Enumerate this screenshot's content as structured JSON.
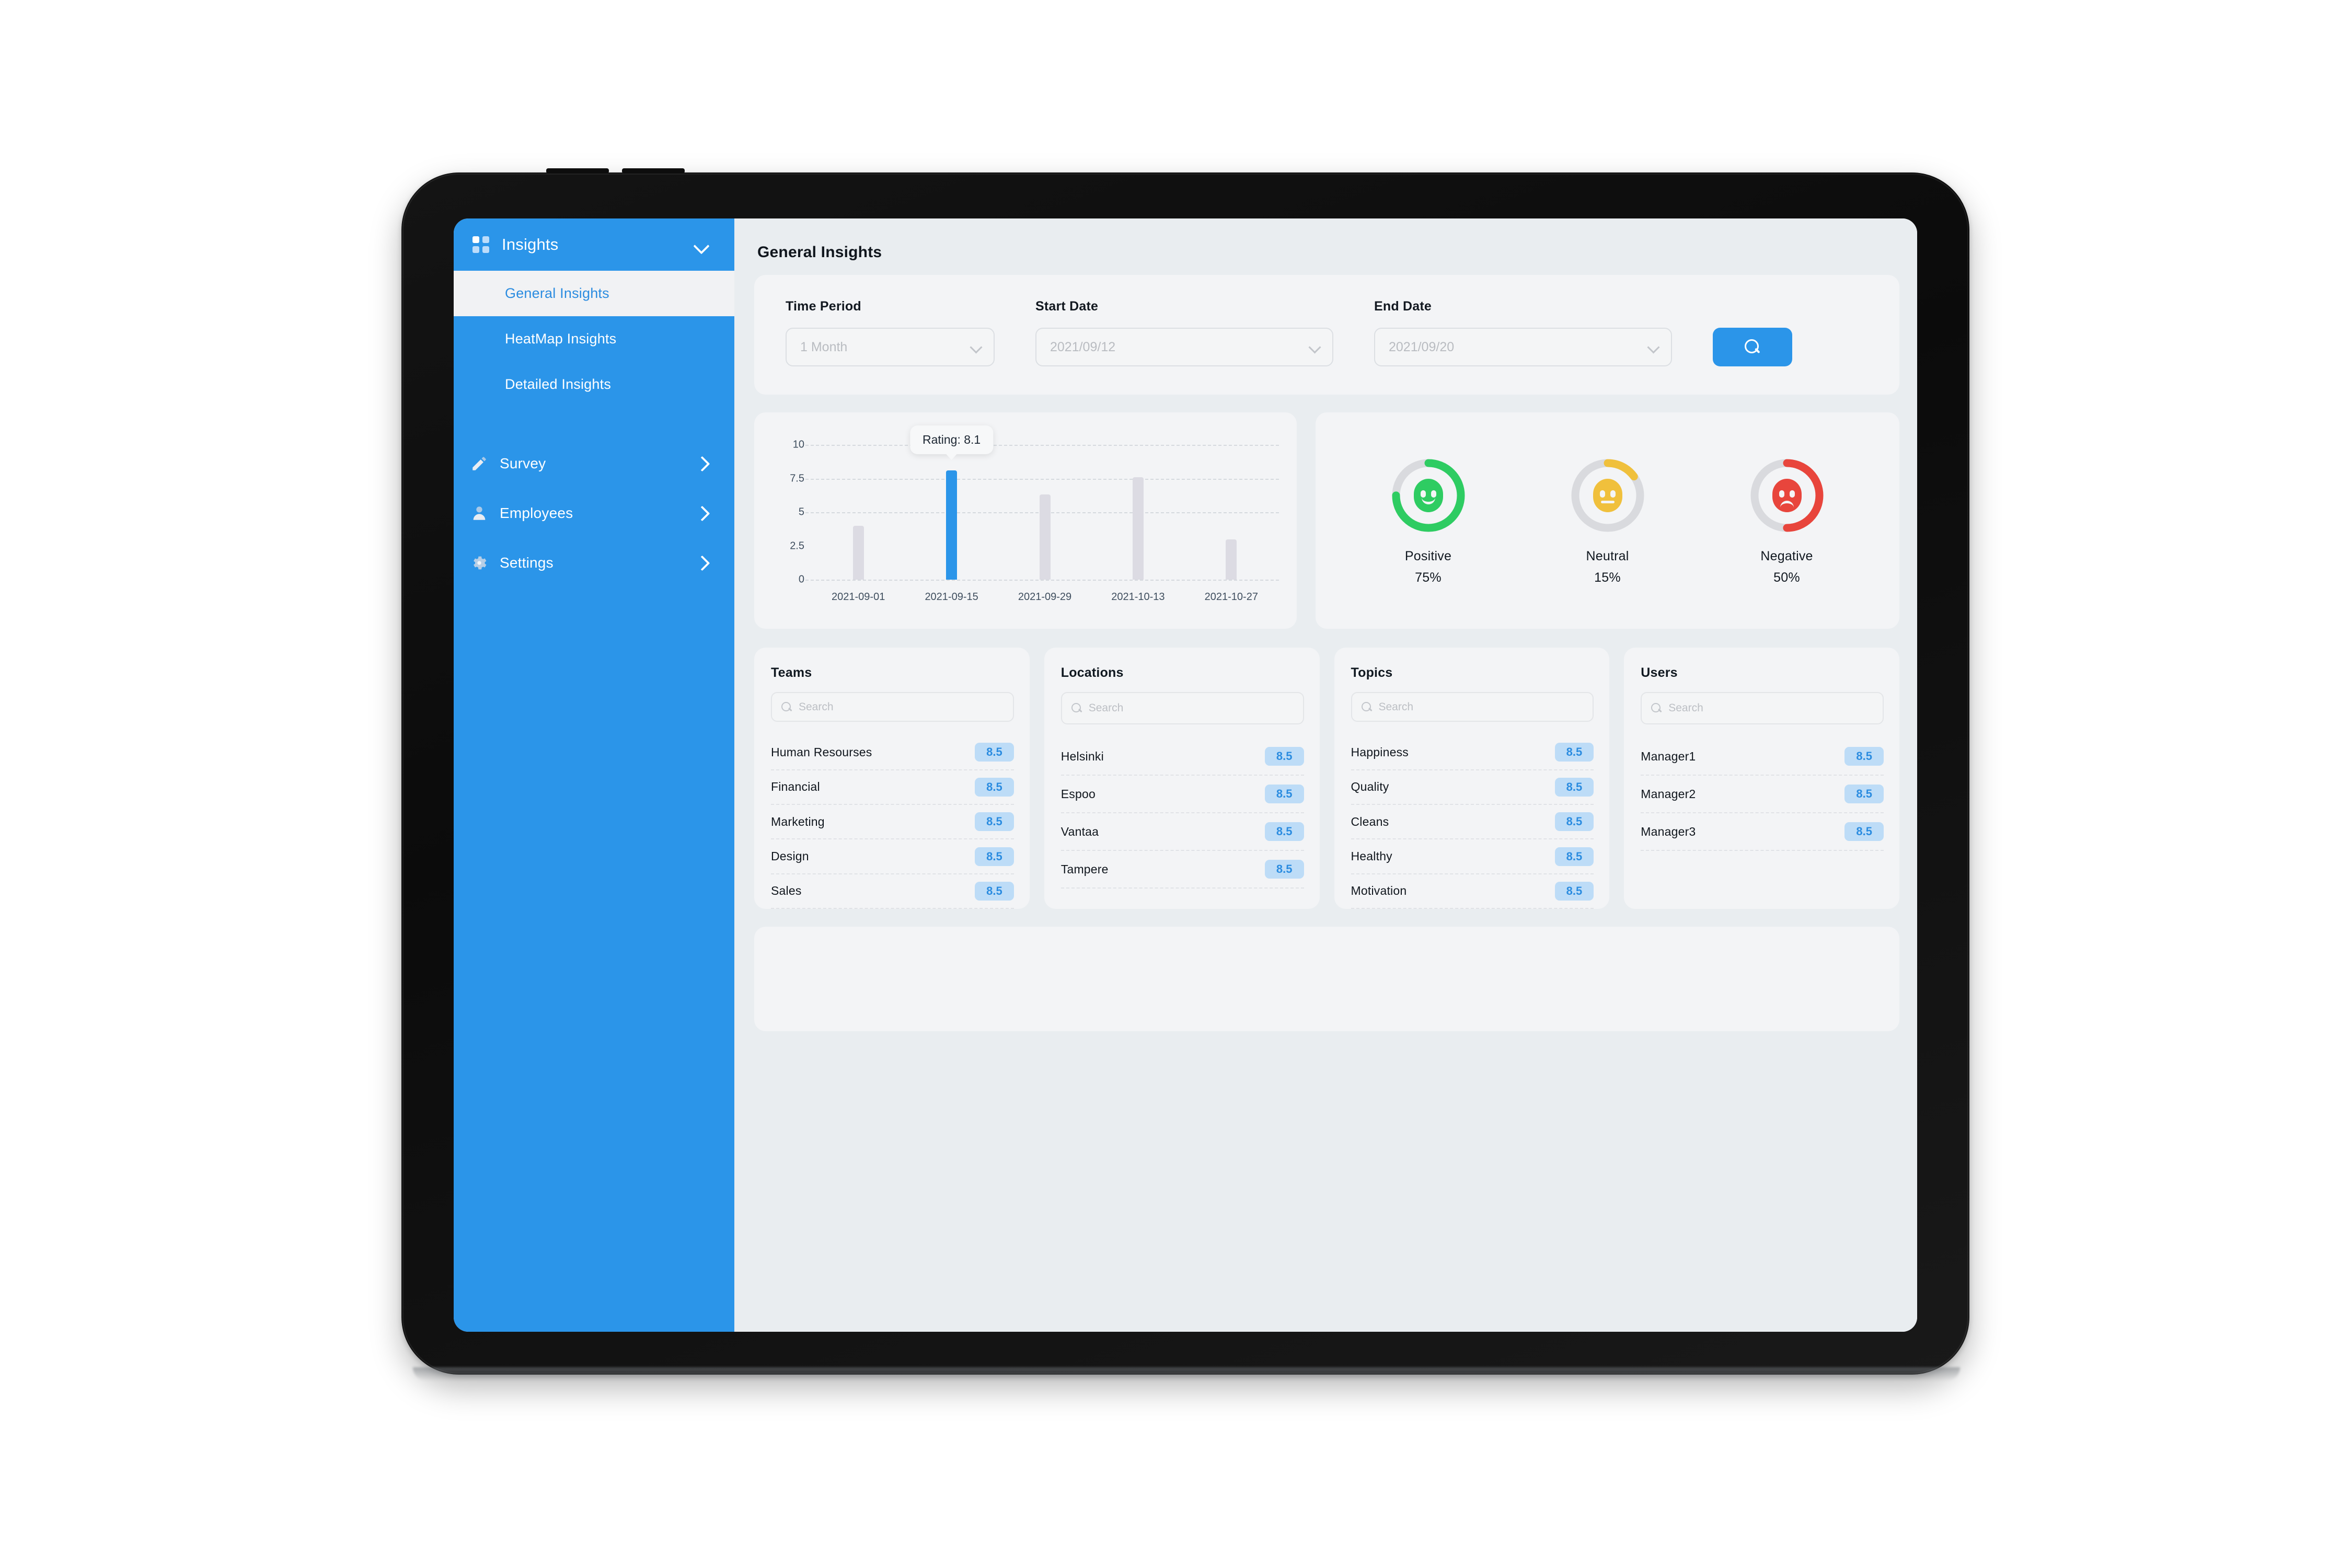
{
  "sidebar": {
    "header": {
      "label": "Insights",
      "icon": "grid-icon",
      "chevron": "chevron-down-icon"
    },
    "sub_items": [
      {
        "label": "General Insights",
        "active": true
      },
      {
        "label": "HeatMap Insights",
        "active": false
      },
      {
        "label": "Detailed Insights",
        "active": false
      }
    ],
    "nav_items": [
      {
        "label": "Survey",
        "icon": "pencil-icon",
        "chevron": "chevron-right-icon"
      },
      {
        "label": "Employees",
        "icon": "person-icon",
        "chevron": "chevron-right-icon"
      },
      {
        "label": "Settings",
        "icon": "gear-icon",
        "chevron": "chevron-right-icon"
      }
    ]
  },
  "page": {
    "title": "General Insights"
  },
  "filters": {
    "time_period": {
      "label": "Time Period",
      "value": "1 Month",
      "placeholder": "1 Month"
    },
    "start_date": {
      "label": "Start Date",
      "value": "2021/09/12",
      "placeholder": "2021/09/12"
    },
    "end_date": {
      "label": "End Date",
      "value": "2021/09/20",
      "placeholder": "2021/09/20"
    },
    "search_button": {
      "icon": "search-icon",
      "label": ""
    }
  },
  "chart_data": {
    "type": "bar",
    "title": "",
    "xlabel": "",
    "ylabel": "",
    "ylim": [
      0,
      10
    ],
    "yticks": [
      "0",
      "2.5",
      "5",
      "7.5",
      "10"
    ],
    "grid": true,
    "categories": [
      "2021-09-01",
      "2021-09-15",
      "2021-09-29",
      "2021-10-13",
      "2021-10-27"
    ],
    "values": [
      4.0,
      8.1,
      6.3,
      7.6,
      3.0
    ],
    "highlighted_index": 1,
    "highlight_color": "#2b95e9",
    "bar_color": "#dcdbe3",
    "tooltip": "Rating: 8.1",
    "series": [
      {
        "name": "Rating",
        "values": [
          4.0,
          8.1,
          6.3,
          7.6,
          3.0
        ]
      }
    ]
  },
  "sentiment": [
    {
      "label": "Positive",
      "value": "75%",
      "percent": 75,
      "color": "#2ecc62",
      "face": "smile-icon"
    },
    {
      "label": "Neutral",
      "value": "15%",
      "percent": 15,
      "color": "#f0c03c",
      "face": "neutral-icon"
    },
    {
      "label": "Negative",
      "value": "50%",
      "percent": 50,
      "color": "#e8453c",
      "face": "frown-icon"
    }
  ],
  "lists": [
    {
      "title": "Teams",
      "search_placeholder": "Search",
      "rows": [
        {
          "name": "Human Resourses",
          "score": "8.5"
        },
        {
          "name": "Financial",
          "score": "8.5"
        },
        {
          "name": "Marketing",
          "score": "8.5"
        },
        {
          "name": "Design",
          "score": "8.5"
        },
        {
          "name": "Sales",
          "score": "8.5"
        }
      ]
    },
    {
      "title": "Locations",
      "search_placeholder": "Search",
      "rows": [
        {
          "name": "Helsinki",
          "score": "8.5"
        },
        {
          "name": "Espoo",
          "score": "8.5"
        },
        {
          "name": "Vantaa",
          "score": "8.5"
        },
        {
          "name": "Tampere",
          "score": "8.5"
        }
      ]
    },
    {
      "title": "Topics",
      "search_placeholder": "Search",
      "rows": [
        {
          "name": "Happiness",
          "score": "8.5"
        },
        {
          "name": "Quality",
          "score": "8.5"
        },
        {
          "name": "Cleans",
          "score": "8.5"
        },
        {
          "name": "Healthy",
          "score": "8.5"
        },
        {
          "name": "Motivation",
          "score": "8.5"
        }
      ]
    },
    {
      "title": "Users",
      "search_placeholder": "Search",
      "rows": [
        {
          "name": "Manager1",
          "score": "8.5"
        },
        {
          "name": "Manager2",
          "score": "8.5"
        },
        {
          "name": "Manager3",
          "score": "8.5"
        }
      ]
    }
  ],
  "colors": {
    "brand_blue": "#2b95e9",
    "screen_bg": "#e9edf0",
    "card_bg": "#f3f4f6",
    "score_badge_bg": "#bddcf7",
    "score_badge_text": "#2b8ce0"
  }
}
